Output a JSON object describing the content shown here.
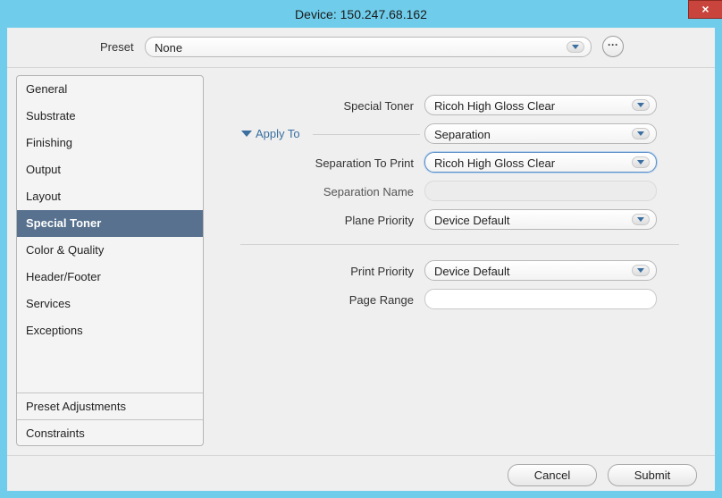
{
  "window": {
    "title": "Device: 150.247.68.162",
    "close_glyph": "×"
  },
  "preset": {
    "label": "Preset",
    "value": "None",
    "more_glyph": "···"
  },
  "sidebar": {
    "items": [
      {
        "label": "General"
      },
      {
        "label": "Substrate"
      },
      {
        "label": "Finishing"
      },
      {
        "label": "Output"
      },
      {
        "label": "Layout"
      },
      {
        "label": "Special Toner",
        "selected": true
      },
      {
        "label": "Color & Quality"
      },
      {
        "label": "Header/Footer"
      },
      {
        "label": "Services"
      },
      {
        "label": "Exceptions"
      }
    ],
    "bottom_items": [
      {
        "label": "Preset Adjustments"
      },
      {
        "label": "Constraints"
      }
    ]
  },
  "form": {
    "special_toner": {
      "label": "Special Toner",
      "value": "Ricoh High Gloss Clear"
    },
    "apply_to": {
      "label": "Apply To",
      "expanded": true,
      "value": "Separation"
    },
    "separation_to_print": {
      "label": "Separation To Print",
      "value": "Ricoh High Gloss Clear"
    },
    "separation_name": {
      "label": "Separation Name",
      "value": "",
      "disabled": true
    },
    "plane_priority": {
      "label": "Plane Priority",
      "value": "Device Default"
    },
    "print_priority": {
      "label": "Print Priority",
      "value": "Device Default"
    },
    "page_range": {
      "label": "Page Range",
      "value": ""
    }
  },
  "footer": {
    "cancel_label": "Cancel",
    "submit_label": "Submit"
  },
  "colors": {
    "titlebar": "#6fcdeb",
    "selected_item": "#57718e",
    "accent": "#3a6fa0",
    "close_button": "#c9443c"
  },
  "icons": {
    "close": "close-icon",
    "more": "more-icon",
    "dropdown": "chevron-down-icon",
    "disclosure": "disclosure-triangle-icon"
  }
}
